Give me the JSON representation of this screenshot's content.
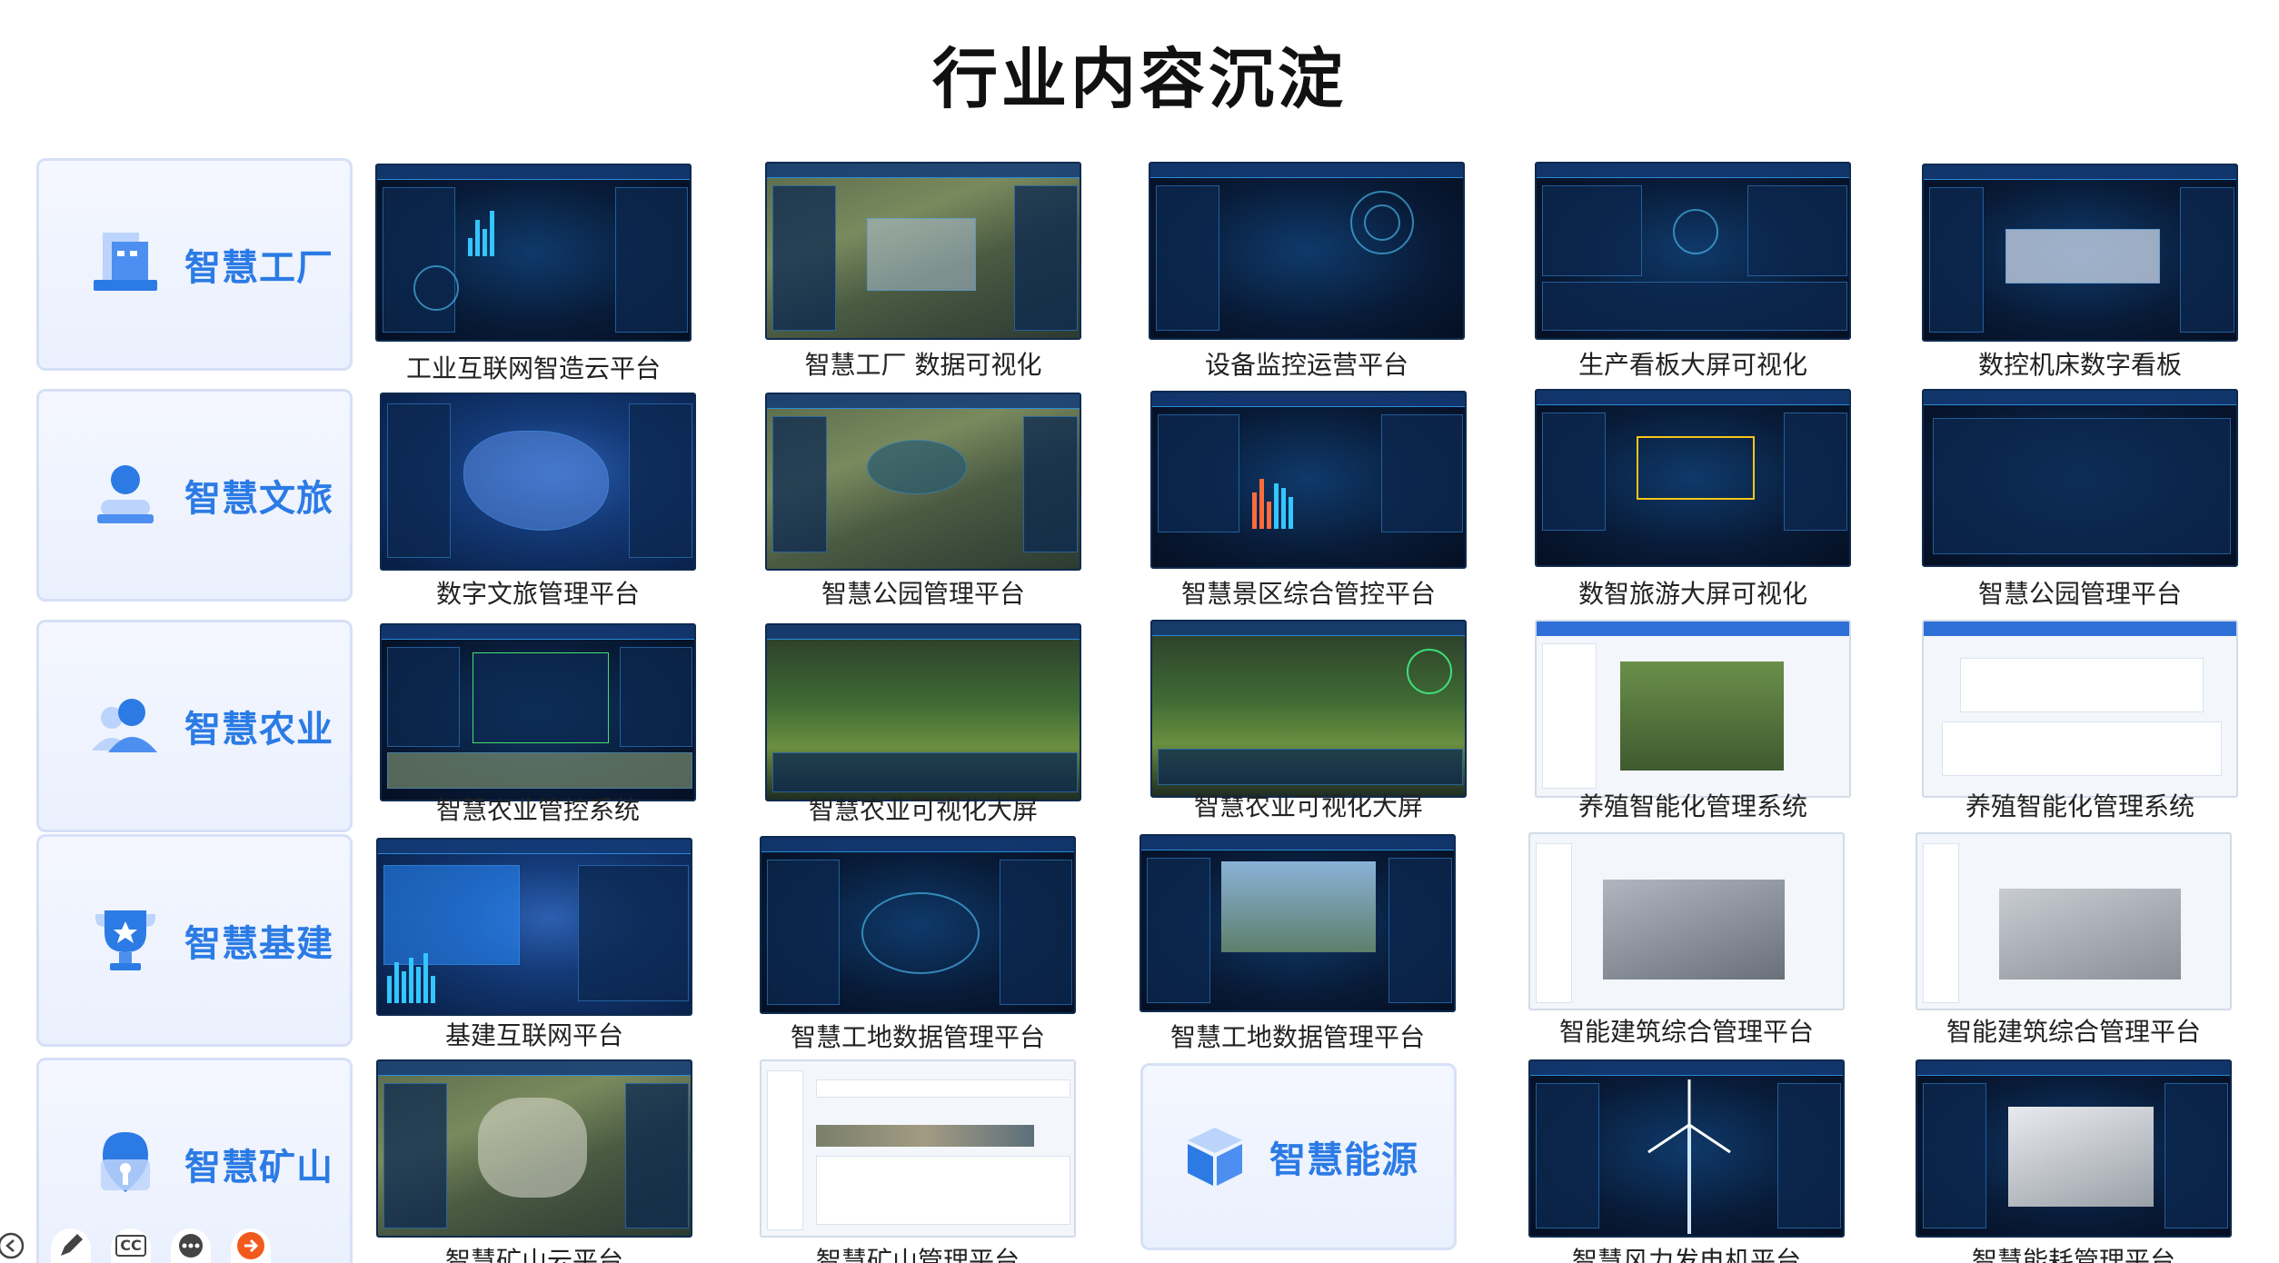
{
  "title": "行业内容沉淀",
  "categories": [
    {
      "label": "智慧工厂",
      "icon": "factory-icon"
    },
    {
      "label": "智慧文旅",
      "icon": "user-card-icon"
    },
    {
      "label": "智慧农业",
      "icon": "people-icon"
    },
    {
      "label": "智慧基建",
      "icon": "trophy-icon"
    },
    {
      "label": "智慧矿山",
      "icon": "location-pin-icon"
    }
  ],
  "rows": [
    [
      "工业互联网智造云平台",
      "智慧工厂 数据可视化",
      "设备监控运营平台",
      "生产看板大屏可视化",
      "数控机床数字看板"
    ],
    [
      "数字文旅管理平台",
      "智慧公园管理平台",
      "智慧景区综合管控平台",
      "数智旅游大屏可视化",
      "智慧公园管理平台"
    ],
    [
      "智慧农业管控系统",
      "智慧农业可视化大屏",
      "智慧农业可视化大屏",
      "养殖智能化管理系统",
      "养殖智能化管理系统"
    ],
    [
      "基建互联网平台",
      "智慧工地数据管理平台",
      "智慧工地数据管理平台",
      "智能建筑综合管理平台",
      "智能建筑综合管理平台"
    ],
    [
      "智慧矿山云平台",
      "智慧矿山管理平台",
      "",
      "智慧风力发电机平台",
      "智慧能耗管理平台"
    ]
  ],
  "energy": {
    "label": "智慧能源",
    "icon": "box-icon"
  },
  "toolbar": {
    "back_icon": "back-arrow-icon",
    "pen_icon": "pen-icon",
    "cc_label": "CC",
    "more_icon": "more-dots-icon",
    "next_icon": "next-arrow-icon"
  },
  "colors": {
    "accent": "#2c7be5",
    "card_bg": "#eef3fe",
    "next_button": "#f25a1d"
  }
}
